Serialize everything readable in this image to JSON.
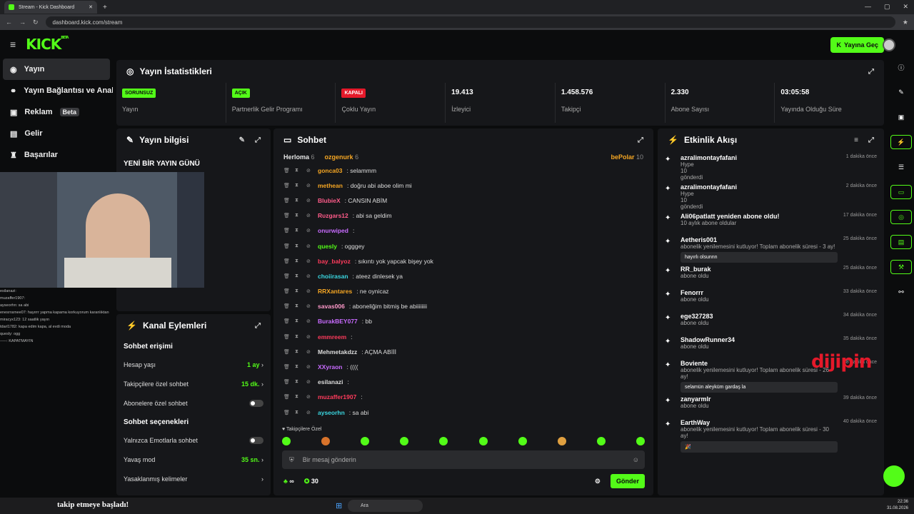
{
  "browser": {
    "tab_title": "Stream - Kick Dashboard",
    "url": "dashboard.kick.com/stream"
  },
  "topbar": {
    "logo": "KICK",
    "logo_badge": "BETA",
    "go_live": "Yayına Geç"
  },
  "sidebar": {
    "items": [
      {
        "label": "Yayın"
      },
      {
        "label": "Yayın Bağlantısı ve Anahtar"
      },
      {
        "label": "Reklam",
        "badge": "Beta"
      },
      {
        "label": "Gelir"
      },
      {
        "label": "Başarılar"
      }
    ]
  },
  "stats": {
    "title": "Yayın İstatistikleri",
    "items": [
      {
        "tag": "SORUNSUZ",
        "label": "Yayın"
      },
      {
        "tag": "AÇIK",
        "label": "Partnerlik Gelir Programı"
      },
      {
        "tag": "KAPALI",
        "label": "Çoklu Yayın"
      },
      {
        "value": "19.413",
        "label": "İzleyici"
      },
      {
        "value": "1.458.576",
        "label": "Takipçi"
      },
      {
        "value": "2.330",
        "label": "Abone Sayısı"
      },
      {
        "value": "03:05:58",
        "label": "Yayında Olduğu Süre"
      }
    ]
  },
  "stream_info": {
    "title": "Yayın bilgisi",
    "stream_title": "YENİ BİR YAYIN GÜNÜ"
  },
  "channel_actions": {
    "title": "Kanal Eylemleri",
    "chat_access": "Sohbet erişimi",
    "rows1": [
      {
        "label": "Hesap yaşı",
        "value": "1 ay"
      },
      {
        "label": "Takipçilere özel sohbet",
        "value": "15 dk."
      },
      {
        "label": "Abonelere özel sohbet",
        "value": ""
      }
    ],
    "chat_options": "Sohbet seçenekleri",
    "rows2": [
      {
        "label": "Yalnızca Emotlarla sohbet",
        "value": ""
      },
      {
        "label": "Yavaş mod",
        "value": "35 sn."
      },
      {
        "label": "Yasaklanmış kelimeler",
        "value": ""
      }
    ]
  },
  "chat": {
    "title": "Sohbet",
    "pinned": [
      {
        "name": "Herloma",
        "count": "6"
      },
      {
        "name": "ozgenurk",
        "count": "6"
      },
      {
        "name": "bePolar",
        "count": "10"
      }
    ],
    "messages": [
      {
        "user": "gonca03",
        "color": "#f5a623",
        "text": ": selammm"
      },
      {
        "user": "methean",
        "color": "#f5a623",
        "text": ": doğru abi aboe olim mi"
      },
      {
        "user": "BlubieX",
        "color": "#ff5c8a",
        "text": ": CANSIN ABİM"
      },
      {
        "user": "Rυzgars12",
        "color": "#ff5c8a",
        "text": ": abi sa geldim"
      },
      {
        "user": "onurwiped",
        "color": "#c86bff",
        "text": ":"
      },
      {
        "user": "quesly",
        "color": "#53fc18",
        "text": ": ogggey"
      },
      {
        "user": "bay_balyoz",
        "color": "#ff3b5c",
        "text": ": sıkıntı yok yapcak bişey yok"
      },
      {
        "user": "choiirasan",
        "color": "#3ad6e0",
        "text": ": ateez dinlesek ya"
      },
      {
        "user": "RRXantares",
        "color": "#f5a623",
        "text": ": ne oynicaz"
      },
      {
        "user": "savas006",
        "color": "#ff9acb",
        "text": ": aboneliğim bitmiş be abiiiiiiii"
      },
      {
        "user": "BurakBEY077",
        "color": "#c86bff",
        "text": ": bb"
      },
      {
        "user": "emmreem",
        "color": "#ff3b5c",
        "text": ":"
      },
      {
        "user": "Mehmetakdzz",
        "color": "#ddd",
        "text": ": AÇMA ABİİİ"
      },
      {
        "user": "XXyraon",
        "color": "#c86bff",
        "text": ": (((("
      },
      {
        "user": "esilanazi",
        "color": "#ddd",
        "text": ":"
      },
      {
        "user": "muzaffer1907",
        "color": "#ff3b5c",
        "text": ":"
      },
      {
        "user": "ayseorhn",
        "color": "#3ad6e0",
        "text": ": sa abi"
      }
    ],
    "followers_only": "Takipçilere Özel",
    "input_placeholder": "Bir mesaj gönderin",
    "infinity": "∞",
    "points": "30",
    "send": "Gönder"
  },
  "activity": {
    "title": "Etkinlik Akışı",
    "items": [
      {
        "name": "azralimontayfafani",
        "time": "1 dakika önce",
        "line1": "Hype",
        "line2": "10",
        "line3": "gönderdi"
      },
      {
        "name": "azralimontayfafani",
        "time": "2 dakika önce",
        "line1": "Hype",
        "line2": "10",
        "line3": "gönderdi"
      },
      {
        "name": "Ali06patlatt yeniden abone oldu!",
        "time": "17 dakika önce",
        "line1": "10 aylık abone oldular"
      },
      {
        "name": "Aetheris001",
        "time": "25 dakika önce",
        "line1": "abonelik yenilemesini kutluyor! Toplam abonelik süresi - 3 ay!",
        "reply": "hayırlı olsunnn"
      },
      {
        "name": "RR_burak",
        "time": "25 dakika önce",
        "line1": "abone oldu"
      },
      {
        "name": "Fenorrr",
        "time": "33 dakika önce",
        "line1": "abone oldu"
      },
      {
        "name": "ege327283",
        "time": "34 dakika önce",
        "line1": "abone oldu"
      },
      {
        "name": "ShadowRunner34",
        "time": "35 dakika önce",
        "line1": "abone oldu"
      },
      {
        "name": "Boviente",
        "time": "38 dakika önce",
        "line1": "abonelik yenilemesini kutluyor! Toplam abonelik süresi - 26 ay!",
        "reply": "selamün aleyküm gardaş la"
      },
      {
        "name": "zanyarmlr",
        "time": "39 dakika önce",
        "line1": "abone oldu"
      },
      {
        "name": "EarthWay",
        "time": "40 dakika önce",
        "line1": "abonelik yenilemesini kutluyor! Toplam abonelik süresi - 30 ay!",
        "reply": "🎉"
      }
    ]
  },
  "overlay": {
    "follow_text": "takip etmeye başladı!",
    "watermark_a": "diji",
    "watermark_b": "pin",
    "chat_lines": [
      "esilanazi:",
      "muzaffer1907:",
      "ayseorhn: sa abi",
      "enesrrarnee07: hayırrr yapma kapama korkuyorum karanlıktan",
      "miracyx123: 12 saatlik yayın",
      "tdarl1782: kapa edim kapa, al evdi moda",
      "quesly: ogg",
      "-----: KAPATMAYIN"
    ]
  },
  "taskbar": {
    "search": "Ara",
    "time": "22:36",
    "date": "31.08.2026"
  },
  "colors": {
    "accent": "#53fc18",
    "panel": "#16171a",
    "bg": "#0b0c0d"
  }
}
